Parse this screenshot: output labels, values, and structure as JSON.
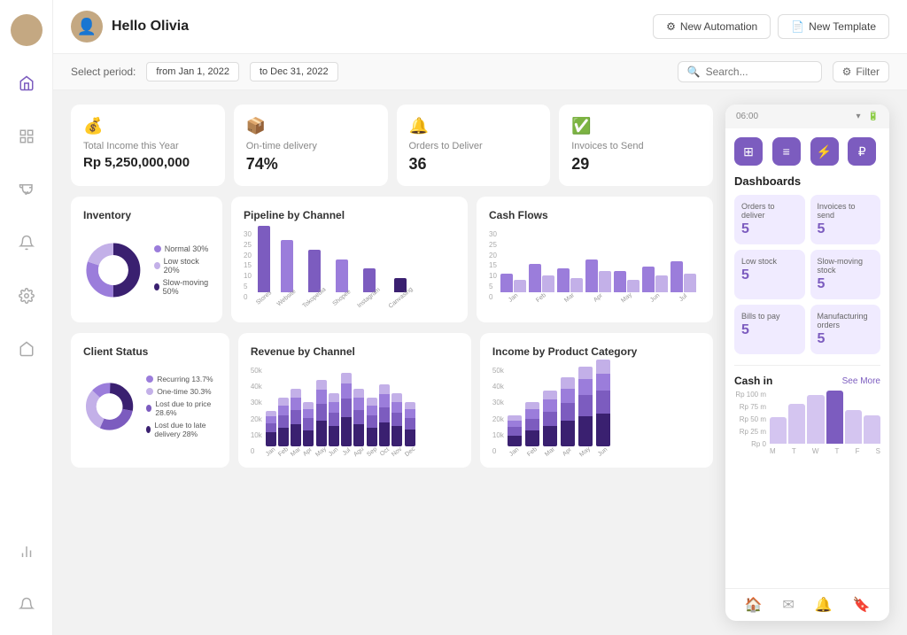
{
  "header": {
    "greeting": "Hello Olivia",
    "btn_automation": "New Automation",
    "btn_template": "New Template"
  },
  "toolbar": {
    "select_period_label": "Select period:",
    "from_date": "from Jan 1, 2022",
    "to_date": "to Dec 31, 2022",
    "search_placeholder": "Search...",
    "filter_label": "Filter"
  },
  "kpis": [
    {
      "label": "Total Income this Year",
      "value": "Rp 5,250,000,000",
      "icon": "💰"
    },
    {
      "label": "On-time delivery",
      "value": "74%",
      "icon": "📦"
    },
    {
      "label": "Orders to Deliver",
      "value": "36",
      "icon": "🔔"
    },
    {
      "label": "Invoices to Send",
      "value": "29",
      "icon": "✅"
    }
  ],
  "inventory": {
    "title": "Inventory",
    "segments": [
      {
        "label": "Normal 30%",
        "color": "#9b7ddb",
        "value": 30
      },
      {
        "label": "Low stock 20%",
        "color": "#c3b0e8",
        "value": 20
      },
      {
        "label": "Slow-moving 50%",
        "color": "#5a3e96",
        "value": 50
      }
    ]
  },
  "pipeline": {
    "title": "Pipeline by Channel",
    "y_labels": [
      "30",
      "25",
      "20",
      "15",
      "10",
      "5",
      "0"
    ],
    "bars": [
      {
        "label": "Stores",
        "value": 28,
        "color": "#7c5cbf"
      },
      {
        "label": "Website",
        "value": 22,
        "color": "#9b7ddb"
      },
      {
        "label": "Tokopedia",
        "value": 18,
        "color": "#7c5cbf"
      },
      {
        "label": "Shopee",
        "value": 14,
        "color": "#9b7ddb"
      },
      {
        "label": "Instagram",
        "value": 10,
        "color": "#7c5cbf"
      },
      {
        "label": "Canvasing",
        "value": 6,
        "color": "#3a2070"
      }
    ]
  },
  "cashflows": {
    "title": "Cash Flows",
    "y_labels": [
      "30",
      "25",
      "20",
      "15",
      "10",
      "5",
      "0"
    ],
    "months": [
      "Jan",
      "Feb",
      "Mar",
      "Apr",
      "May",
      "Jun",
      "Jul"
    ],
    "bars_in": [
      8,
      12,
      10,
      14,
      9,
      11,
      13
    ],
    "bars_out": [
      5,
      7,
      6,
      9,
      5,
      7,
      8
    ]
  },
  "client_status": {
    "title": "Client Status",
    "segments": [
      {
        "label": "Recurring 13.7%",
        "color": "#9b7ddb",
        "value": 13.7
      },
      {
        "label": "One-time 30.3%",
        "color": "#c3b0e8",
        "value": 30.3
      },
      {
        "label": "Lost due to price 28.6%",
        "color": "#7c5cbf",
        "value": 28.6
      },
      {
        "label": "Lost due to late delivery 28%",
        "color": "#3a2070",
        "value": 28
      }
    ]
  },
  "revenue_by_channel": {
    "title": "Revenue by Channel",
    "y_labels": [
      "50,000",
      "40,000",
      "30,000",
      "20,000",
      "10,000",
      "0"
    ],
    "months": [
      "Jan",
      "Feb",
      "Mar",
      "Apr",
      "May",
      "Jun",
      "Jul",
      "Agu",
      "Sep",
      "Oct",
      "Nov",
      "Dec"
    ],
    "series": [
      {
        "color": "#3a2070"
      },
      {
        "color": "#7c5cbf"
      },
      {
        "color": "#9b7ddb"
      },
      {
        "color": "#c3b0e8"
      }
    ],
    "data": [
      [
        8,
        10,
        12,
        9,
        14,
        11,
        15,
        12,
        10,
        13,
        11,
        9
      ],
      [
        5,
        7,
        8,
        6,
        9,
        7,
        10,
        8,
        7,
        9,
        7,
        6
      ],
      [
        4,
        5,
        6,
        5,
        7,
        5,
        8,
        6,
        5,
        7,
        5,
        4
      ],
      [
        3,
        4,
        4,
        3,
        5,
        4,
        6,
        4,
        3,
        5,
        4,
        3
      ]
    ]
  },
  "income_by_category": {
    "title": "Income by Product Category",
    "y_labels": [
      "50,000",
      "40,000",
      "30,000",
      "20,000",
      "10,000",
      "0"
    ],
    "months": [
      "Jan",
      "Feb",
      "Mar",
      "Apr",
      "May",
      "Jun"
    ],
    "series": [
      {
        "color": "#3a2070"
      },
      {
        "color": "#7c5cbf"
      },
      {
        "color": "#9b7ddb"
      },
      {
        "color": "#c3b0e8"
      }
    ],
    "data": [
      [
        5,
        8,
        10,
        12,
        15,
        18
      ],
      [
        4,
        6,
        8,
        10,
        12,
        14
      ],
      [
        3,
        5,
        6,
        8,
        10,
        12
      ],
      [
        2,
        3,
        4,
        5,
        7,
        8
      ]
    ]
  },
  "panel": {
    "header_time": "06:00",
    "icons": [
      "⊞",
      "≡",
      "⚡",
      "₽"
    ],
    "section_title": "Dashboards",
    "items": [
      {
        "label": "Orders to deliver",
        "value": "5"
      },
      {
        "label": "Invoices to send",
        "value": "5"
      },
      {
        "label": "Low stock",
        "value": "5"
      },
      {
        "label": "Slow-moving stock",
        "value": "5"
      },
      {
        "label": "Bills to pay",
        "value": "5"
      },
      {
        "label": "Manufacturing orders",
        "value": "5"
      }
    ],
    "cash_in_title": "Cash in",
    "see_more": "See More",
    "cash_y_labels": [
      "Rp 100 m",
      "Rp 75 m",
      "Rp 50 m",
      "Rp 25 m",
      "Rp 0"
    ],
    "cash_x_labels": [
      "M",
      "T",
      "W",
      "T",
      "F",
      "S"
    ],
    "cash_bars": [
      30,
      45,
      55,
      90,
      40,
      35
    ],
    "nav_icons": [
      "🏠",
      "✉",
      "🔔",
      "🔖"
    ]
  }
}
